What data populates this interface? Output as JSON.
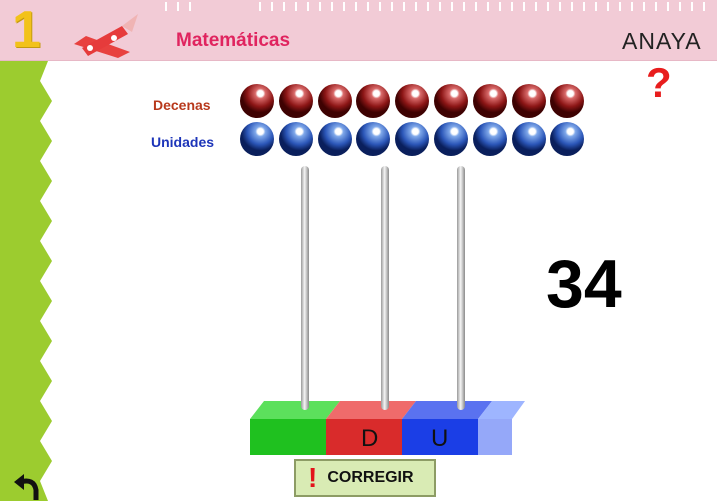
{
  "header": {
    "grade": "1",
    "subject": "Matemáticas",
    "brand": "ANAYA",
    "tools_icon": "ruler-pencil-icon",
    "help_icon": "question-mark-icon",
    "help_symbol": "?"
  },
  "abacus": {
    "tens_label": "Decenas",
    "units_label": "Unidades",
    "tens_beads_available": 9,
    "units_beads_available": 9,
    "tens_color": "#8d1616",
    "units_color": "#2b56b8",
    "positions": [
      {
        "label": "",
        "color": "#1fc11f"
      },
      {
        "label": "D",
        "color": "#d92b2b"
      },
      {
        "label": "U",
        "color": "#1b3ee6"
      }
    ]
  },
  "target_number": "34",
  "actions": {
    "check_label": "CORREGIR",
    "check_icon": "exclamation-icon",
    "check_symbol": "!",
    "back_icon": "back-arrow-icon"
  }
}
